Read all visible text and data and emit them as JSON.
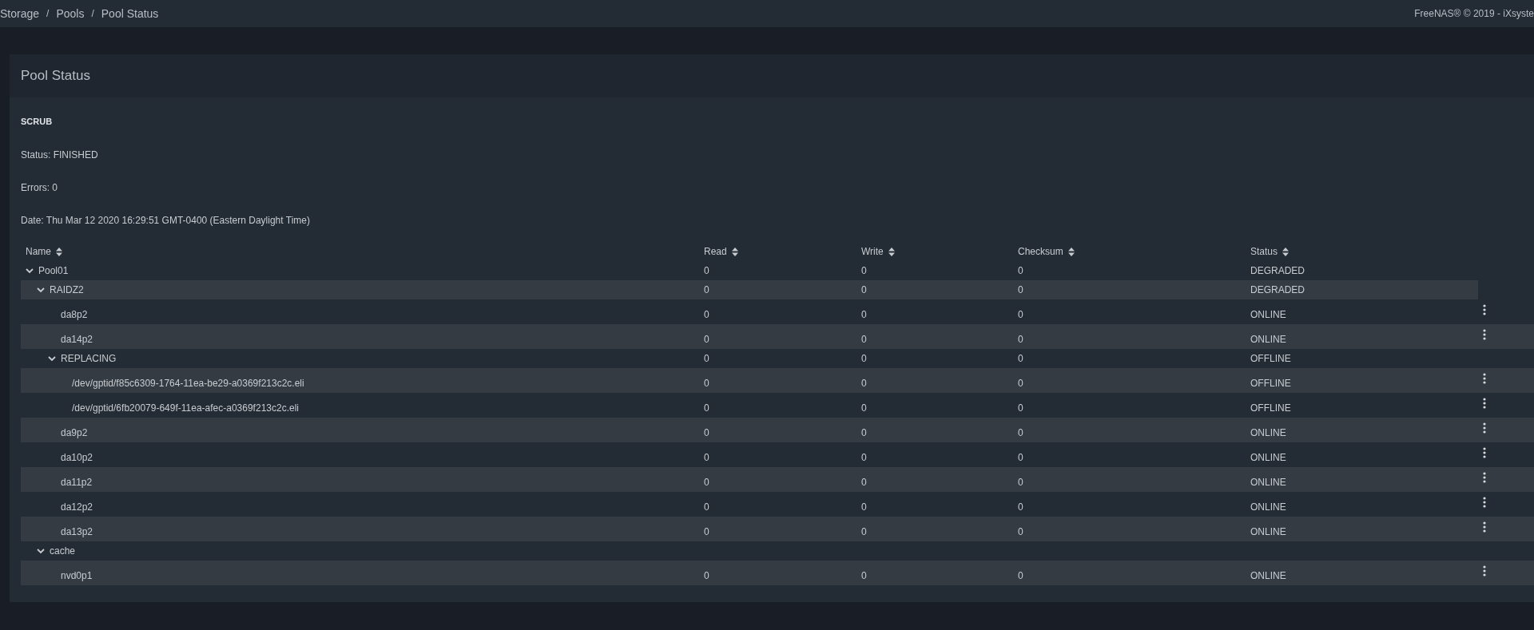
{
  "breadcrumb": [
    "Storage",
    "Pools",
    "Pool Status"
  ],
  "breadcrumb_separator": "/",
  "copyright": "FreeNAS® © 2019 - iXsyste",
  "panel": {
    "title": "Pool Status",
    "scrub": {
      "heading": "SCRUB",
      "lines": [
        "Status: FINISHED",
        "Errors: 0",
        "Date: Thu Mar 12 2020 16:29:51 GMT-0400 (Eastern Daylight Time)"
      ]
    },
    "table": {
      "columns": [
        "Name",
        "Read",
        "Write",
        "Checksum",
        "Status"
      ],
      "rows": [
        {
          "kind": "group",
          "name": "Pool01",
          "read": "0",
          "write": "0",
          "checksum": "0",
          "status": "DEGRADED",
          "expanded": true,
          "children": [
            {
              "kind": "group",
              "name": "RAIDZ2",
              "read": "0",
              "write": "0",
              "checksum": "0",
              "status": "DEGRADED",
              "expanded": true,
              "children": [
                {
                  "kind": "device",
                  "name": "da8p2",
                  "read": "0",
                  "write": "0",
                  "checksum": "0",
                  "status": "ONLINE"
                },
                {
                  "kind": "device",
                  "name": "da14p2",
                  "read": "0",
                  "write": "0",
                  "checksum": "0",
                  "status": "ONLINE"
                },
                {
                  "kind": "group",
                  "name": "REPLACING",
                  "read": "0",
                  "write": "0",
                  "checksum": "0",
                  "status": "OFFLINE",
                  "expanded": true,
                  "children": [
                    {
                      "kind": "device",
                      "name": "/dev/gptid/f85c6309-1764-11ea-be29-a0369f213c2c.eli",
                      "read": "0",
                      "write": "0",
                      "checksum": "0",
                      "status": "OFFLINE"
                    },
                    {
                      "kind": "device",
                      "name": "/dev/gptid/6fb20079-649f-11ea-afec-a0369f213c2c.eli",
                      "read": "0",
                      "write": "0",
                      "checksum": "0",
                      "status": "OFFLINE"
                    }
                  ]
                },
                {
                  "kind": "device",
                  "name": "da9p2",
                  "read": "0",
                  "write": "0",
                  "checksum": "0",
                  "status": "ONLINE"
                },
                {
                  "kind": "device",
                  "name": "da10p2",
                  "read": "0",
                  "write": "0",
                  "checksum": "0",
                  "status": "ONLINE"
                },
                {
                  "kind": "device",
                  "name": "da11p2",
                  "read": "0",
                  "write": "0",
                  "checksum": "0",
                  "status": "ONLINE"
                },
                {
                  "kind": "device",
                  "name": "da12p2",
                  "read": "0",
                  "write": "0",
                  "checksum": "0",
                  "status": "ONLINE"
                },
                {
                  "kind": "device",
                  "name": "da13p2",
                  "read": "0",
                  "write": "0",
                  "checksum": "0",
                  "status": "ONLINE"
                }
              ]
            },
            {
              "kind": "group",
              "name": "cache",
              "expanded": true,
              "children": [
                {
                  "kind": "device",
                  "name": "nvd0p1",
                  "read": "0",
                  "write": "0",
                  "checksum": "0",
                  "status": "ONLINE"
                }
              ]
            }
          ]
        }
      ]
    }
  }
}
